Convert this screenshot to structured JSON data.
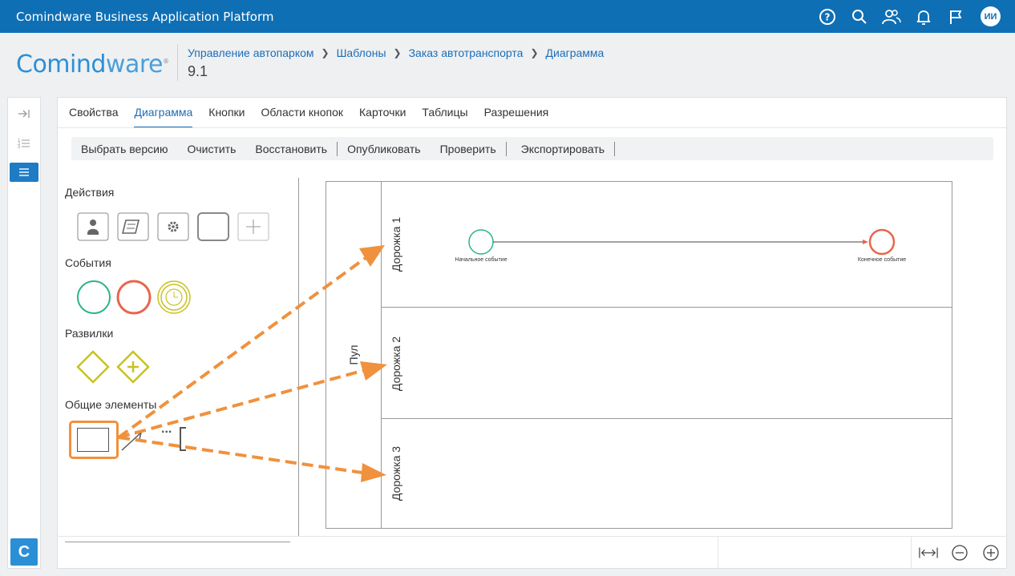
{
  "app": {
    "title": "Comindware Business Application Platform",
    "avatar_initials": "ИИ"
  },
  "top_icons": [
    "help-icon",
    "search-icon",
    "users-icon",
    "bell-icon",
    "flag-icon"
  ],
  "logo": {
    "part1": "Comind",
    "part2": "ware",
    "reg": "®"
  },
  "breadcrumb": [
    "Управление автопарком",
    "Шаблоны",
    "Заказ автотранспорта",
    "Диаграмма"
  ],
  "version": "9.1",
  "tabs": [
    "Свойства",
    "Диаграмма",
    "Кнопки",
    "Области кнопок",
    "Карточки",
    "Таблицы",
    "Разрешения"
  ],
  "active_tab": "Диаграмма",
  "toolbar": [
    "Выбрать версию",
    "Очистить",
    "Восстановить",
    "Опубликовать",
    "Проверить",
    "Экспортировать"
  ],
  "palette": {
    "actions_label": "Действия",
    "events_label": "События",
    "gateways_label": "Развилки",
    "common_label": "Общие элементы",
    "common_more": "..."
  },
  "diagram": {
    "pool": "Пул",
    "lanes": [
      "Дорожка 1",
      "Дорожка 2",
      "Дорожка 3"
    ],
    "start_event": "Начальное событие",
    "end_event": "Конечное событие"
  },
  "colors": {
    "brand": "#0f6fb5",
    "start": "#2bb38a",
    "end": "#e8654b",
    "timer": "#c9c21f",
    "gateway": "#c9c21f",
    "highlight": "#f0913d"
  }
}
